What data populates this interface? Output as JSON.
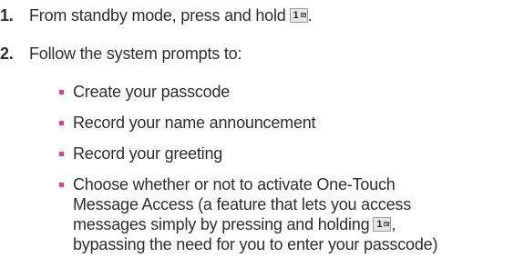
{
  "steps": [
    {
      "number": "1.",
      "text_before_key": "From standby mode, press and hold",
      "key": "1",
      "key_icon": "envelope-icon",
      "text_after_key": "."
    },
    {
      "number": "2.",
      "text": "Follow the system prompts to:",
      "bullets": [
        {
          "lines": [
            "Create your passcode"
          ]
        },
        {
          "lines": [
            "Record your name announcement"
          ]
        },
        {
          "lines": [
            "Record your greeting"
          ]
        },
        {
          "lines": [
            "Choose whether or not to activate One-Touch",
            "Message Access (a feature that lets you access",
            "messages simply by pressing and holding",
            "bypassing the need for you to enter your passcode)"
          ],
          "key": "1",
          "key_after_text": ","
        }
      ]
    }
  ],
  "colors": {
    "bullet": "#e83a92",
    "text": "#2e2e2e",
    "key_bg": "#e6e6e6"
  }
}
